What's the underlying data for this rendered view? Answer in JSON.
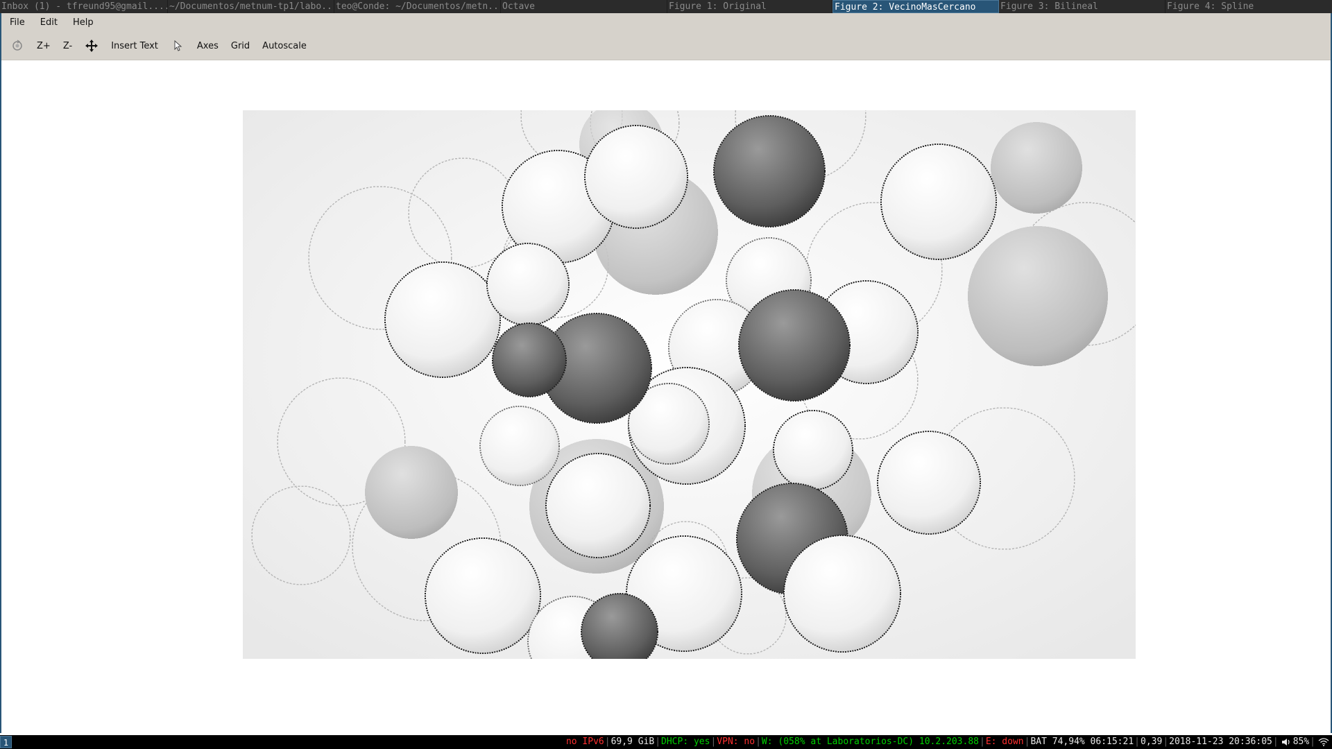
{
  "tabbar": {
    "tabs": [
      {
        "label": "Inbox (1) - tfreund95@gmail....",
        "active": false
      },
      {
        "label": "~/Documentos/metnum-tp1/labo...",
        "active": false
      },
      {
        "label": "teo@Conde: ~/Documentos/metn...",
        "active": false
      },
      {
        "label": "Octave",
        "active": false
      },
      {
        "label": "Figure 1: Original",
        "active": false
      },
      {
        "label": "Figure 2: VecinoMasCercano",
        "active": true
      },
      {
        "label": "Figure 3: Bilineal",
        "active": false
      },
      {
        "label": "Figure 4: Spline",
        "active": false
      }
    ]
  },
  "menubar": {
    "file": "File",
    "edit": "Edit",
    "help": "Help"
  },
  "toolbar": {
    "rotate_icon": "rotate-icon",
    "zoom_in": "Z+",
    "zoom_out": "Z-",
    "pan_icon": "pan-arrows-icon",
    "insert_text": "Insert Text",
    "select_icon": "pointer-icon",
    "axes": "Axes",
    "grid": "Grid",
    "autoscale": "Autoscale"
  },
  "statusbar": {
    "workspace": "1",
    "ipv6": "no IPv6",
    "disk": "69,9 GiB",
    "dhcp": "DHCP: yes",
    "vpn": "VPN: no",
    "wifi": "W: (058% at Laboratorios-DC) 10.2.203.88",
    "ethernet": "E: down",
    "battery": "BAT 74,94% 06:15:21",
    "load": "0,39",
    "datetime": "2018-11-23 20:36:05",
    "volume": "85%",
    "colors": {
      "bad": "#ff3030",
      "good": "#00d000",
      "accent": "#285577"
    }
  }
}
